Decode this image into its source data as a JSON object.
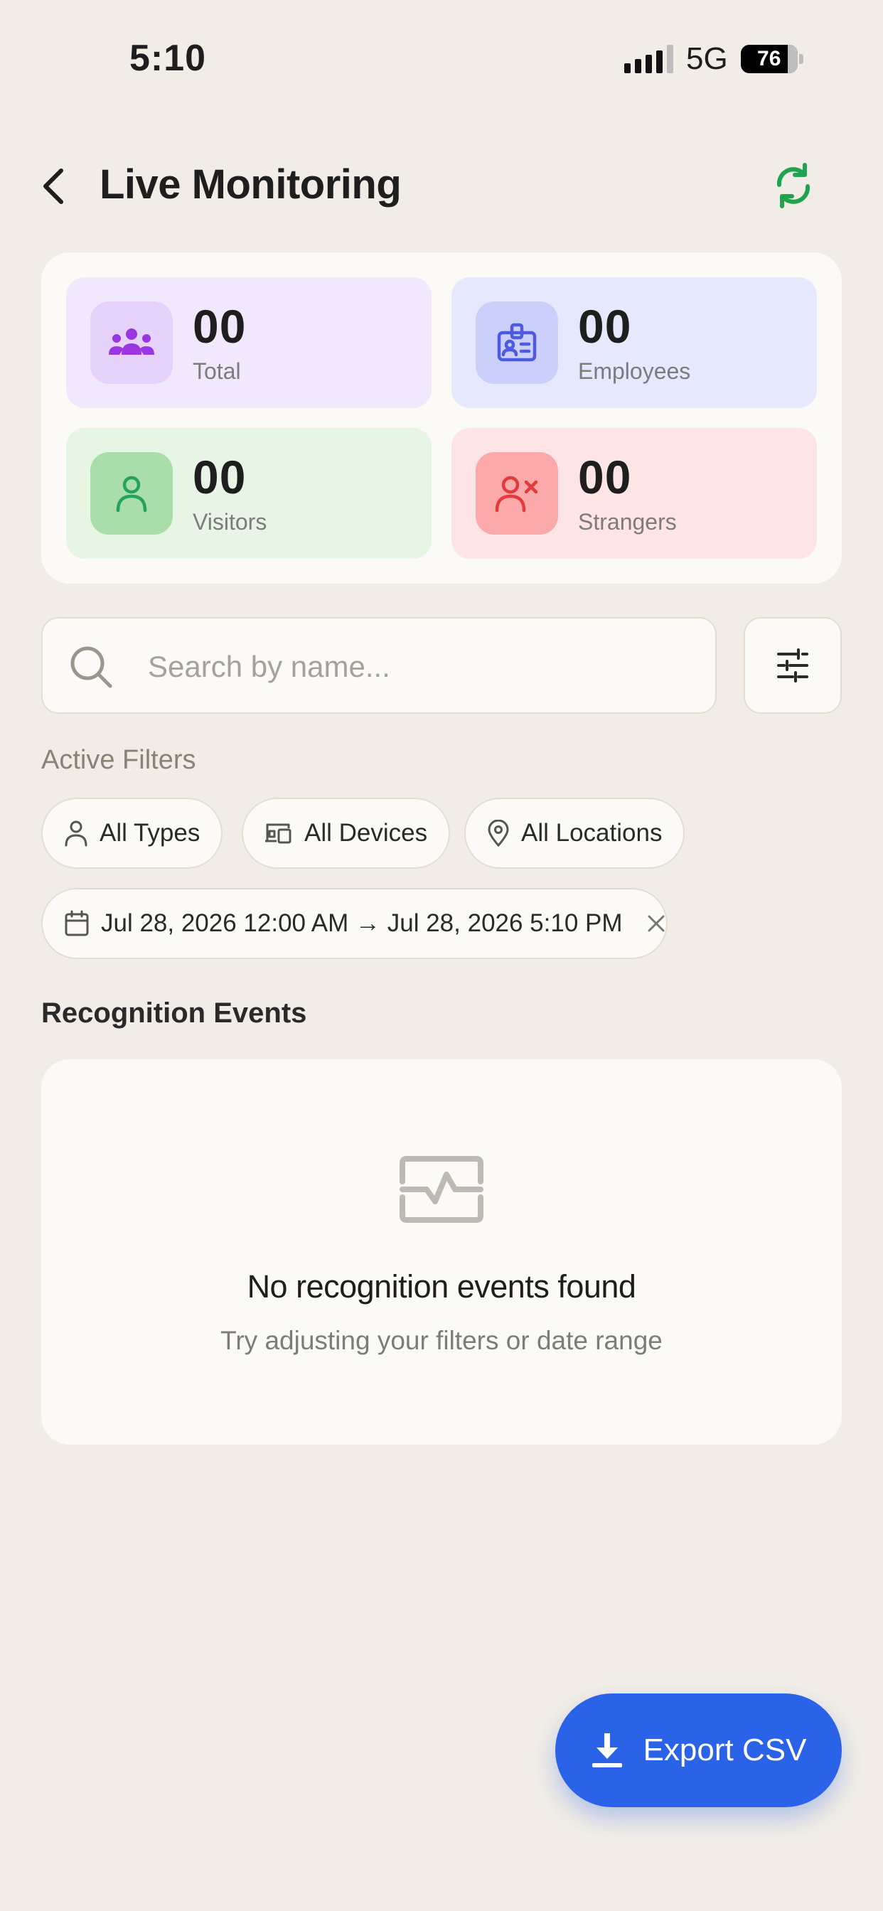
{
  "status_bar": {
    "time": "5:10",
    "network": "5G",
    "battery": "76"
  },
  "header": {
    "title": "Live Monitoring"
  },
  "stats": [
    {
      "value": "00",
      "label": "Total",
      "bg": "#F1E8FD",
      "icon_bg": "#E4D2FB",
      "icon_color": "#9A36E0",
      "icon": "people-icon"
    },
    {
      "value": "00",
      "label": "Employees",
      "bg": "#E6E8FD",
      "icon_bg": "#CBD0FB",
      "icon_color": "#4E5BE0",
      "icon": "id-badge-icon"
    },
    {
      "value": "00",
      "label": "Visitors",
      "bg": "#E6F5E4",
      "icon_bg": "#A9DDA9",
      "icon_color": "#23A35E",
      "icon": "user-icon"
    },
    {
      "value": "00",
      "label": "Strangers",
      "bg": "#FDE5E5",
      "icon_bg": "#FBA9AA",
      "icon_color": "#E23B3B",
      "icon": "user-x-icon"
    }
  ],
  "search": {
    "placeholder": "Search by name..."
  },
  "filters": {
    "label": "Active Filters",
    "chips": [
      {
        "label": "All Types",
        "icon": "user-icon"
      },
      {
        "label": "All Devices",
        "icon": "devices-icon"
      },
      {
        "label": "All Locations",
        "icon": "location-pin-icon"
      }
    ],
    "date_range": "Jul 28, 2026 12:00 AM → Jul 28, 2026 5:10 PM"
  },
  "events": {
    "title": "Recognition Events",
    "empty_title": "No recognition events found",
    "empty_subtitle": "Try adjusting your filters or date range"
  },
  "export_button": {
    "label": "Export CSV"
  },
  "colors": {
    "accent": "#2A62E8",
    "refresh": "#1FA34E",
    "background": "#F1EDE6"
  }
}
